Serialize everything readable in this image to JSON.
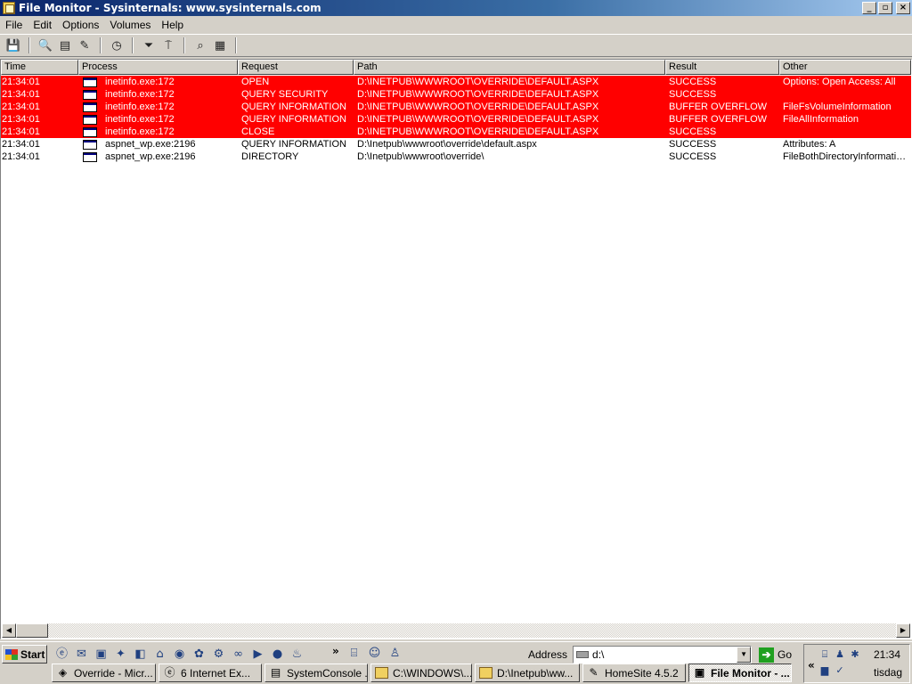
{
  "window": {
    "title": "File Monitor - Sysinternals: www.sysinternals.com"
  },
  "menu": [
    "File",
    "Edit",
    "Options",
    "Volumes",
    "Help"
  ],
  "toolbar_icons": [
    "save-icon",
    "capture-icon",
    "autoscroll-icon",
    "clear-icon",
    "time-icon",
    "filter-icon",
    "highlight-icon",
    "find-icon",
    "explorer-icon"
  ],
  "columns": [
    "Time",
    "Process",
    "Request",
    "Path",
    "Result",
    "Other"
  ],
  "rows": [
    {
      "time": "21:34:01",
      "process": "inetinfo.exe:172",
      "request": "OPEN",
      "path": "D:\\INETPUB\\WWWROOT\\OVERRIDE\\DEFAULT.ASPX",
      "result": "SUCCESS",
      "other": "Options: Open  Access: All",
      "highlighted": true
    },
    {
      "time": "21:34:01",
      "process": "inetinfo.exe:172",
      "request": "QUERY SECURITY",
      "path": "D:\\INETPUB\\WWWROOT\\OVERRIDE\\DEFAULT.ASPX",
      "result": "SUCCESS",
      "other": "",
      "highlighted": true
    },
    {
      "time": "21:34:01",
      "process": "inetinfo.exe:172",
      "request": "QUERY INFORMATION",
      "path": "D:\\INETPUB\\WWWROOT\\OVERRIDE\\DEFAULT.ASPX",
      "result": "BUFFER OVERFLOW",
      "other": "FileFsVolumeInformation",
      "highlighted": true
    },
    {
      "time": "21:34:01",
      "process": "inetinfo.exe:172",
      "request": "QUERY INFORMATION",
      "path": "D:\\INETPUB\\WWWROOT\\OVERRIDE\\DEFAULT.ASPX",
      "result": "BUFFER OVERFLOW",
      "other": "FileAllInformation",
      "highlighted": true
    },
    {
      "time": "21:34:01",
      "process": "inetinfo.exe:172",
      "request": "CLOSE",
      "path": "D:\\INETPUB\\WWWROOT\\OVERRIDE\\DEFAULT.ASPX",
      "result": "SUCCESS",
      "other": "",
      "highlighted": true
    },
    {
      "time": "21:34:01",
      "process": "aspnet_wp.exe:2196",
      "request": "QUERY INFORMATION",
      "path": "D:\\Inetpub\\wwwroot\\override\\default.aspx",
      "result": "SUCCESS",
      "other": "Attributes: A",
      "highlighted": false
    },
    {
      "time": "21:34:01",
      "process": "aspnet_wp.exe:2196",
      "request": "DIRECTORY",
      "path": "D:\\Inetpub\\wwwroot\\override\\",
      "result": "SUCCESS",
      "other": "FileBothDirectoryInformation:...",
      "highlighted": false
    }
  ],
  "colors": {
    "highlight": "#ff0000",
    "title_start": "#0a246a",
    "title_end": "#a6caf0"
  },
  "taskbar": {
    "start_label": "Start",
    "address_label": "Address",
    "address_value": "d:\\",
    "go_label": "Go",
    "tasks": [
      {
        "label": "Override - Micr...",
        "icon": "vs-icon",
        "active": false
      },
      {
        "label": "6 Internet Ex...",
        "icon": "ie-icon",
        "active": false
      },
      {
        "label": "SystemConsole ...",
        "icon": "console-icon",
        "active": false
      },
      {
        "label": "C:\\WINDOWS\\...",
        "icon": "folder-icon",
        "active": false
      },
      {
        "label": "D:\\Inetpub\\ww...",
        "icon": "folder-icon",
        "active": false
      },
      {
        "label": "HomeSite 4.5.2",
        "icon": "homesite-icon",
        "active": false
      },
      {
        "label": "File Monitor - ...",
        "icon": "filemon-icon",
        "active": true
      }
    ],
    "clock": "21:34",
    "day": "tisdag"
  }
}
